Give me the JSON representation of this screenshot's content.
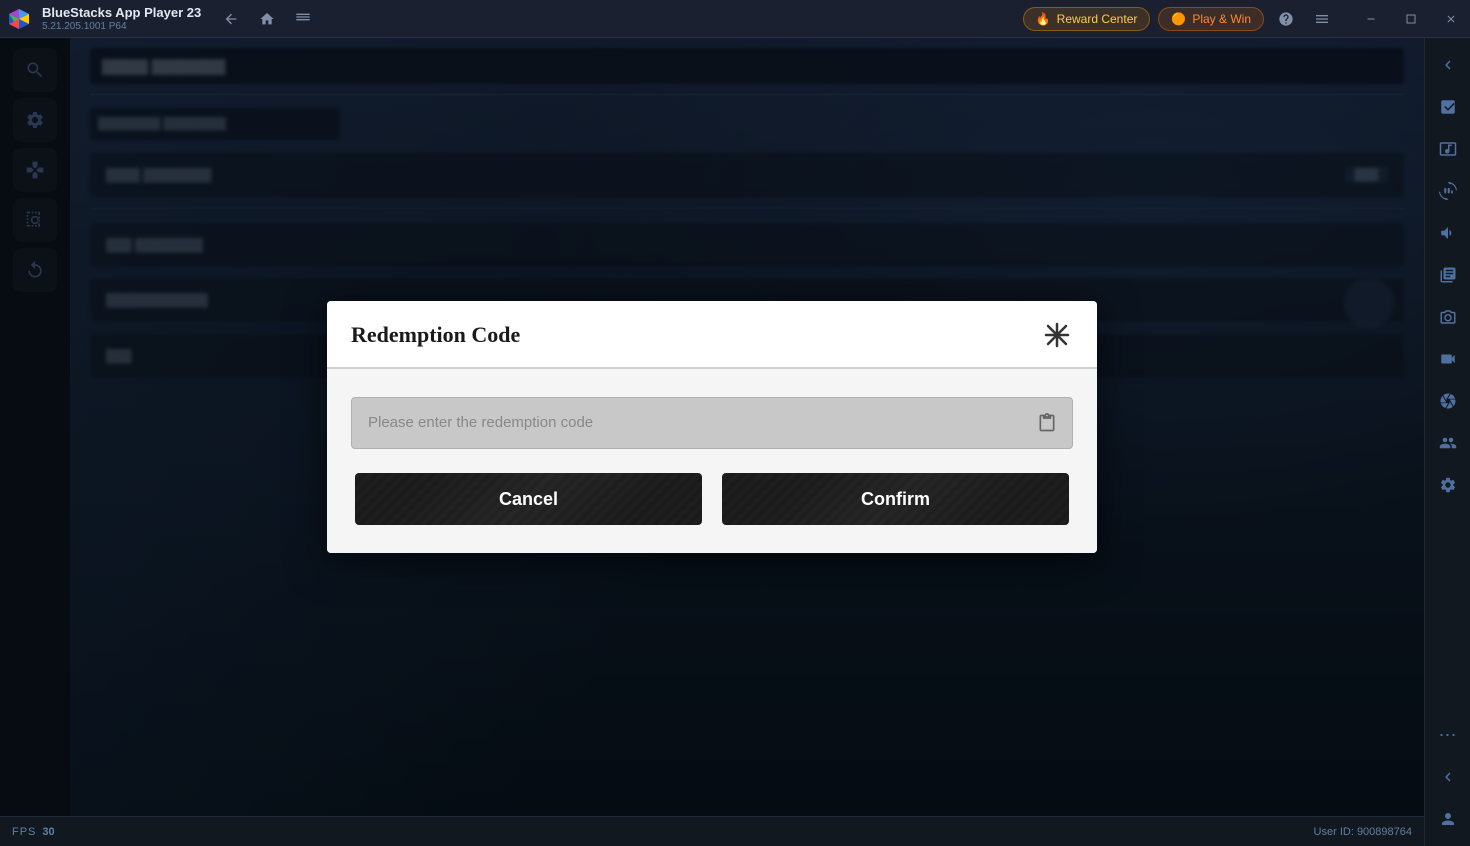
{
  "titlebar": {
    "app_name": "BlueStacks App Player 23",
    "app_version": "5.21.205.1001 P64",
    "reward_center_label": "Reward Center",
    "play_win_label": "Play & Win"
  },
  "dialog": {
    "title": "Redemption Code",
    "input_placeholder": "Please enter the redemption code",
    "cancel_label": "Cancel",
    "confirm_label": "Confirm"
  },
  "bottombar": {
    "fps_label": "FPS",
    "fps_value": "30",
    "user_id_label": "User ID: 900898764"
  },
  "sidebar": {
    "icons": [
      "arrow-left-icon",
      "expand-icon",
      "screen-icon",
      "rotate-icon",
      "volume-icon",
      "library-icon",
      "screenshot-icon",
      "record-icon",
      "camera-icon",
      "gamepad-icon",
      "settings-icon"
    ]
  },
  "left_panel": {
    "icons": [
      "search-icon",
      "settings-icon",
      "gamepad-icon",
      "camera-icon",
      "replay-icon"
    ]
  },
  "colors": {
    "accent_orange": "#ffcc44",
    "accent_red": "#ff8833",
    "bg_dark": "#111820",
    "dialog_bg": "#f5f5f5",
    "button_dark": "#1a1a1a"
  }
}
